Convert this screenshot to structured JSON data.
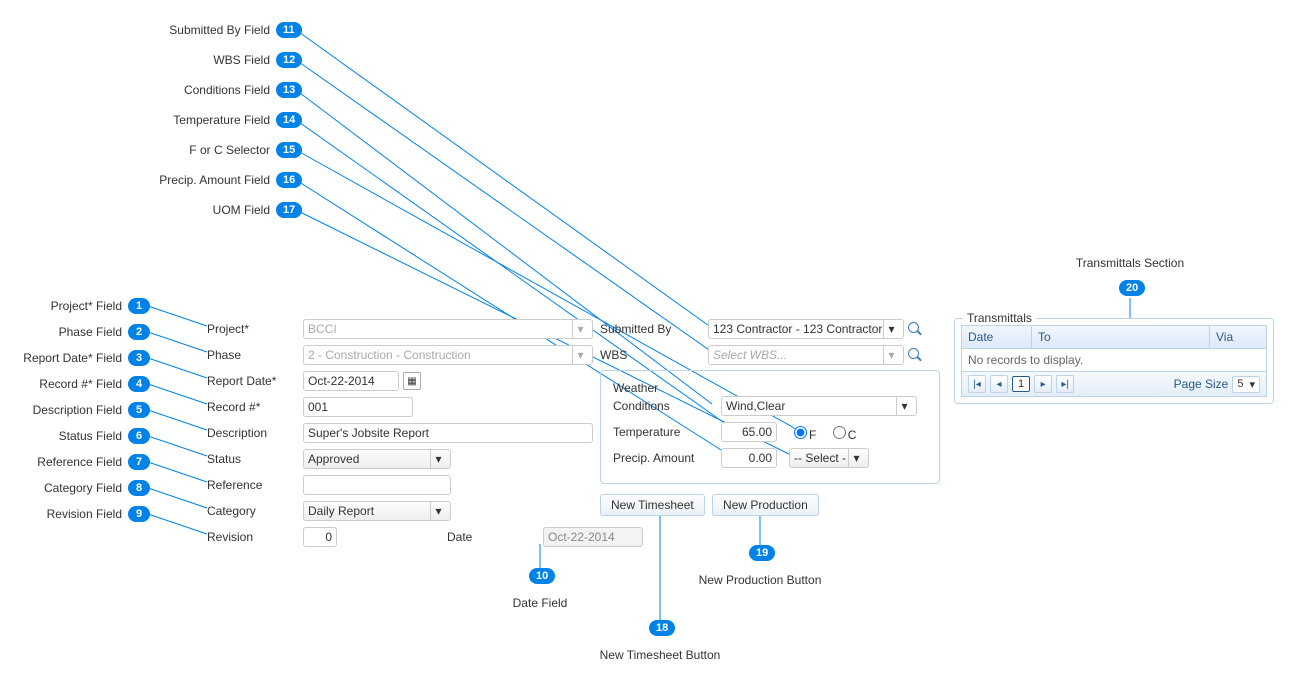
{
  "callouts": {
    "left": [
      {
        "num": "1",
        "label": "Project* Field"
      },
      {
        "num": "2",
        "label": "Phase Field"
      },
      {
        "num": "3",
        "label": "Report Date* Field"
      },
      {
        "num": "4",
        "label": "Record #* Field"
      },
      {
        "num": "5",
        "label": "Description Field"
      },
      {
        "num": "6",
        "label": "Status Field"
      },
      {
        "num": "7",
        "label": "Reference Field"
      },
      {
        "num": "8",
        "label": "Category Field"
      },
      {
        "num": "9",
        "label": "Revision Field"
      }
    ],
    "top": [
      {
        "num": "11",
        "label": "Submitted By Field"
      },
      {
        "num": "12",
        "label": "WBS Field"
      },
      {
        "num": "13",
        "label": "Conditions Field"
      },
      {
        "num": "14",
        "label": "Temperature Field"
      },
      {
        "num": "15",
        "label": "F or C Selector"
      },
      {
        "num": "16",
        "label": "Precip. Amount Field"
      },
      {
        "num": "17",
        "label": "UOM Field"
      }
    ],
    "bottom": [
      {
        "num": "10",
        "label": "Date Field"
      },
      {
        "num": "18",
        "label": "New Timesheet Button"
      },
      {
        "num": "19",
        "label": "New Production Button"
      }
    ],
    "right": [
      {
        "num": "20",
        "label": "Transmittals Section"
      }
    ]
  },
  "form": {
    "project_label": "Project*",
    "project_value": "BCCI",
    "phase_label": "Phase",
    "phase_value": "2 - Construction - Construction",
    "reportdate_label": "Report Date*",
    "reportdate_value": "Oct-22-2014",
    "recordnum_label": "Record #*",
    "recordnum_value": "001",
    "description_label": "Description",
    "description_value": "Super's Jobsite Report",
    "status_label": "Status",
    "status_value": "Approved",
    "reference_label": "Reference",
    "reference_value": "",
    "category_label": "Category",
    "category_value": "Daily Report",
    "revision_label": "Revision",
    "revision_value": "0",
    "date_label": "Date",
    "date_value": "Oct-22-2014"
  },
  "right": {
    "submittedby_label": "Submitted By",
    "submittedby_value": "123 Contractor - 123 Contractor",
    "wbs_label": "WBS",
    "wbs_placeholder": "Select WBS...",
    "weather_legend": "Weather",
    "conditions_label": "Conditions",
    "conditions_value": "Wind,Clear",
    "temperature_label": "Temperature",
    "temperature_value": "65.00",
    "unit_f": "F",
    "unit_c": "C",
    "precip_label": "Precip. Amount",
    "precip_value": "0.00",
    "uom_value": "-- Select -",
    "new_timesheet": "New Timesheet",
    "new_production": "New Production"
  },
  "transmittals": {
    "legend": "Transmittals",
    "col_date": "Date",
    "col_to": "To",
    "col_via": "Via",
    "empty": "No records to display.",
    "page_num": "1",
    "page_size_label": "Page Size",
    "page_size_value": "5"
  }
}
